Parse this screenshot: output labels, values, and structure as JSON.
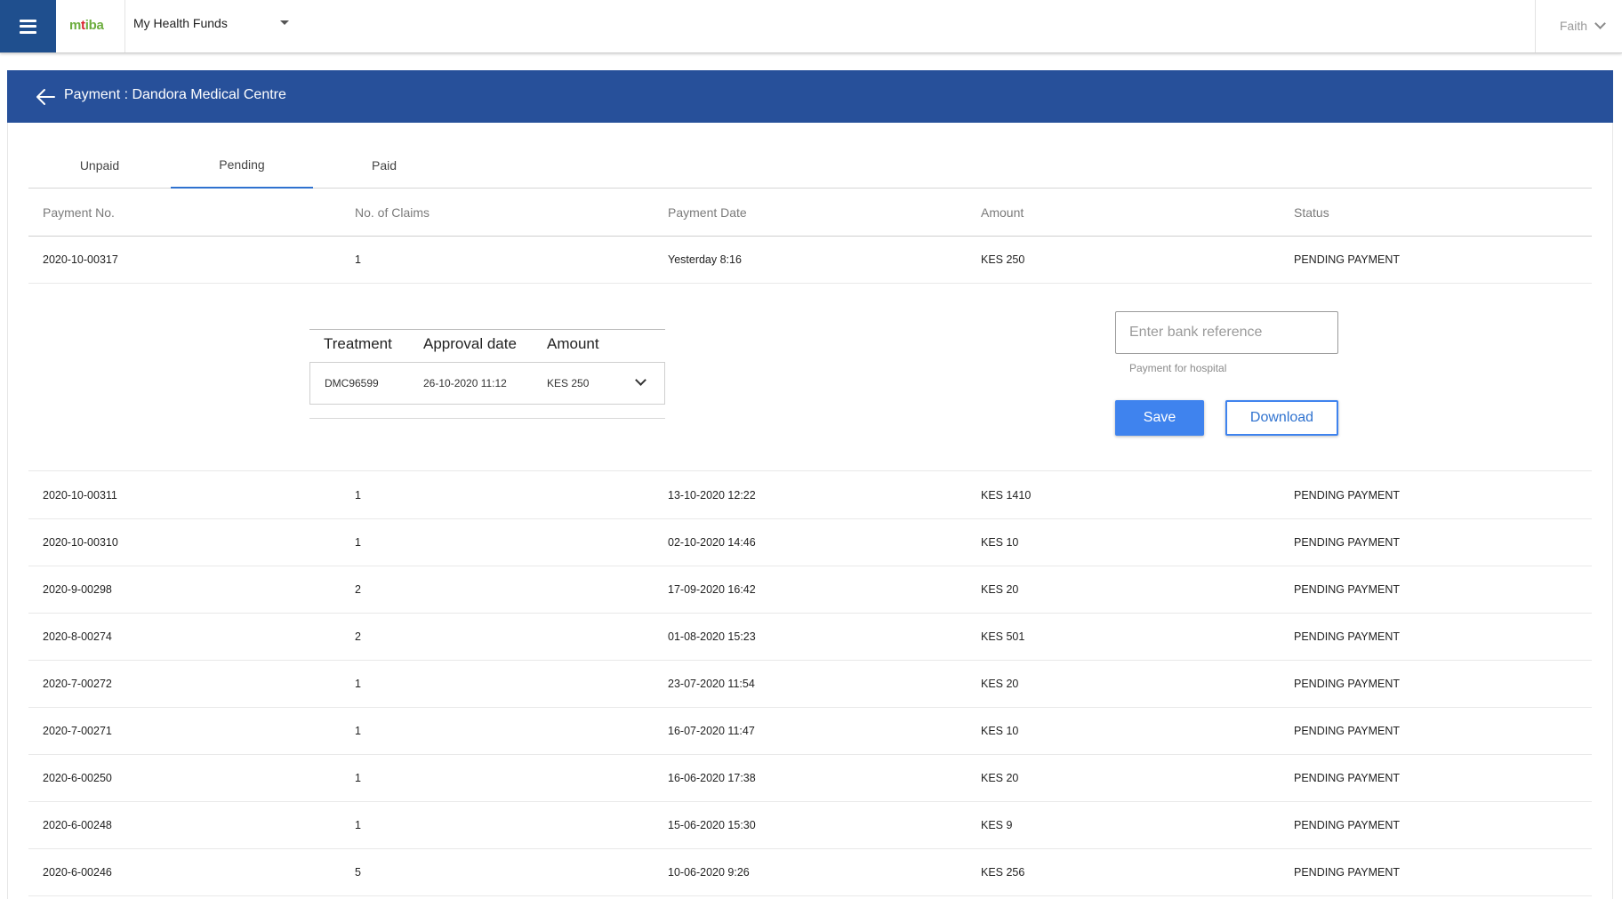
{
  "app": {
    "logo": {
      "m": "m",
      "t": "t",
      "iba": "iba"
    },
    "fund_selector": {
      "value": "My Health Funds"
    },
    "user": {
      "name": "Faith"
    }
  },
  "header": {
    "title": "Payment : Dandora Medical Centre"
  },
  "tabs": [
    {
      "label": "Unpaid",
      "active": false
    },
    {
      "label": "Pending",
      "active": true
    },
    {
      "label": "Paid",
      "active": false
    }
  ],
  "table": {
    "columns": [
      "Payment No.",
      "No. of Claims",
      "Payment Date",
      "Amount",
      "Status"
    ],
    "expanded_row": {
      "payment_no": "2020-10-00317",
      "claims": "1",
      "date": "Yesterday 8:16",
      "amount": "KES 250",
      "status": "PENDING PAYMENT"
    },
    "rows": [
      {
        "payment_no": "2020-10-00311",
        "claims": "1",
        "date": "13-10-2020 12:22",
        "amount": "KES 1410",
        "status": "PENDING PAYMENT"
      },
      {
        "payment_no": "2020-10-00310",
        "claims": "1",
        "date": "02-10-2020 14:46",
        "amount": "KES 10",
        "status": "PENDING PAYMENT"
      },
      {
        "payment_no": "2020-9-00298",
        "claims": "2",
        "date": "17-09-2020 16:42",
        "amount": "KES 20",
        "status": "PENDING PAYMENT"
      },
      {
        "payment_no": "2020-8-00274",
        "claims": "2",
        "date": "01-08-2020 15:23",
        "amount": "KES 501",
        "status": "PENDING PAYMENT"
      },
      {
        "payment_no": "2020-7-00272",
        "claims": "1",
        "date": "23-07-2020 11:54",
        "amount": "KES 20",
        "status": "PENDING PAYMENT"
      },
      {
        "payment_no": "2020-7-00271",
        "claims": "1",
        "date": "16-07-2020 11:47",
        "amount": "KES 10",
        "status": "PENDING PAYMENT"
      },
      {
        "payment_no": "2020-6-00250",
        "claims": "1",
        "date": "16-06-2020 17:38",
        "amount": "KES 20",
        "status": "PENDING PAYMENT"
      },
      {
        "payment_no": "2020-6-00248",
        "claims": "1",
        "date": "15-06-2020 15:30",
        "amount": "KES 9",
        "status": "PENDING PAYMENT"
      },
      {
        "payment_no": "2020-6-00246",
        "claims": "5",
        "date": "10-06-2020 9:26",
        "amount": "KES 256",
        "status": "PENDING PAYMENT"
      }
    ]
  },
  "detail": {
    "sub_table": {
      "headers": [
        "Treatment",
        "Approval date",
        "Amount"
      ],
      "row": {
        "treatment": "DMC96599",
        "approval_date": "26-10-2020 11:12",
        "amount": "KES 250"
      }
    },
    "bank_reference": {
      "value": "",
      "placeholder": "Enter bank reference"
    },
    "hint": "Payment for hospital",
    "save_label": "Save",
    "download_label": "Download"
  },
  "icons": {
    "menu": "hamburger-menu-icon",
    "fund_caret": "caret-down-icon",
    "user_chevron": "chevron-down-icon",
    "back": "arrow-left-icon",
    "expand": "chevron-down-icon"
  },
  "colors": {
    "primary_blue": "#27509a",
    "menu_blue": "#1f4f8e",
    "accent_blue": "#3f83ee",
    "logo_green": "#6cad3d",
    "logo_red": "#d9232d"
  }
}
